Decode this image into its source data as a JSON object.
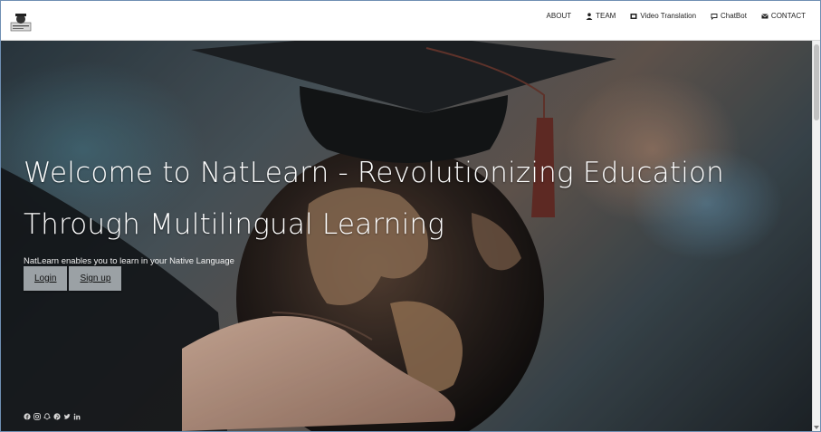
{
  "nav": {
    "about": "ABOUT",
    "team": "TEAM",
    "video": "Video Translation",
    "chatbot": "ChatBot",
    "contact": "CONTACT"
  },
  "hero": {
    "headline_line1": "Welcome to NatLearn - Revolutionizing Education",
    "headline_line2": "Through Multilingual Learning",
    "subtitle": "NatLearn enables you to learn in your Native Language",
    "login": "Login",
    "signup": "Sign up"
  },
  "socials": [
    "facebook-icon",
    "instagram-icon",
    "snapchat-icon",
    "pinterest-icon",
    "twitter-icon",
    "linkedin-icon"
  ],
  "colors": {
    "navbar_bg": "#ffffff",
    "button_bg": "#9ba1a5",
    "hero_text": "#ffffff"
  }
}
